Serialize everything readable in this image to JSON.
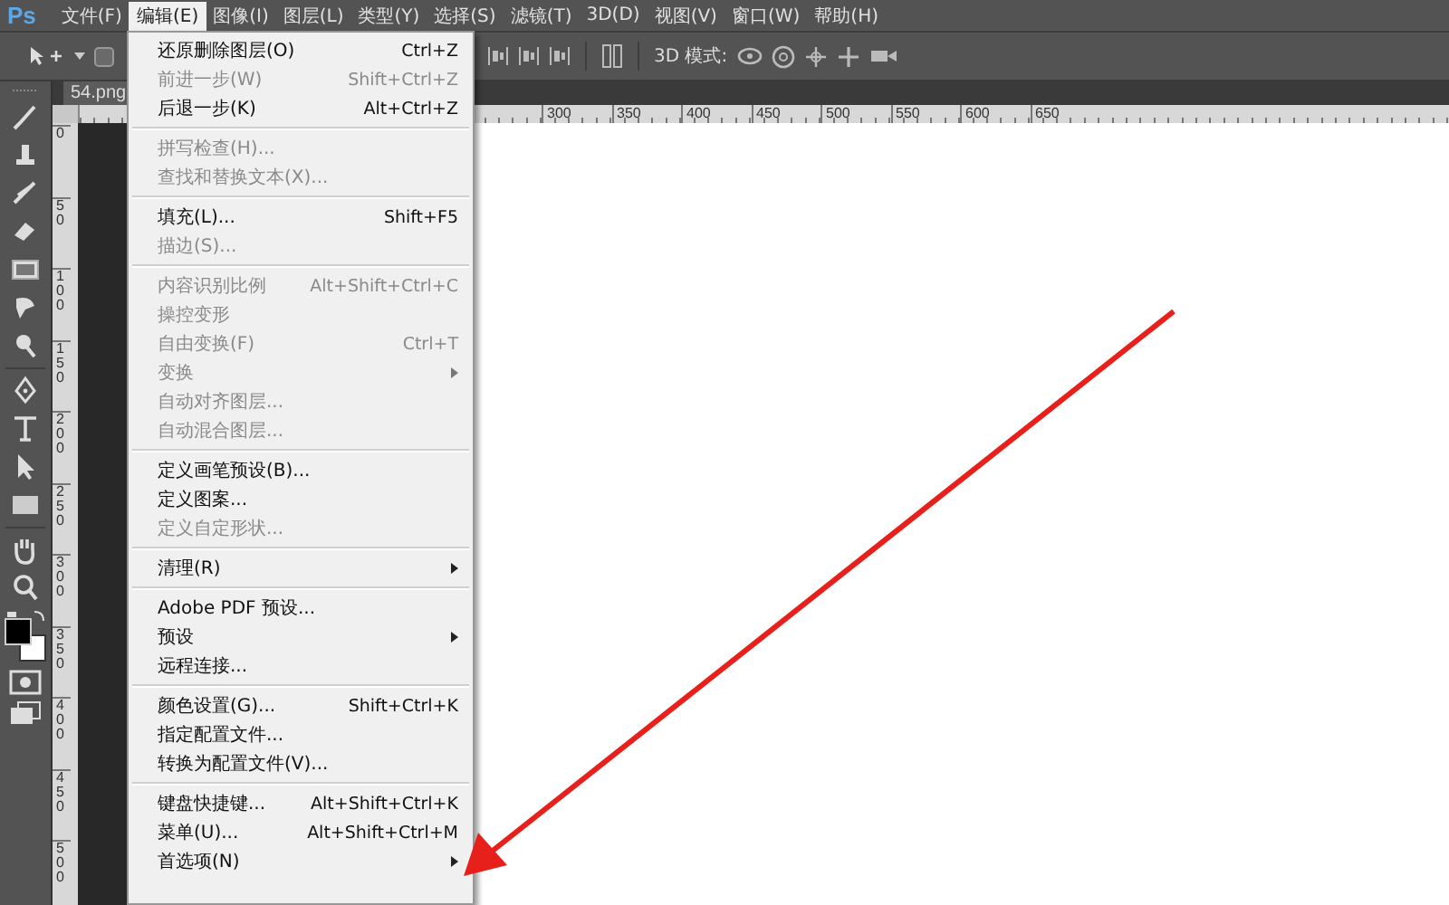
{
  "app": {
    "logo": "Ps"
  },
  "menu_bar": [
    {
      "label": "文件(F)",
      "selected": false
    },
    {
      "label": "编辑(E)",
      "selected": true
    },
    {
      "label": "图像(I)",
      "selected": false
    },
    {
      "label": "图层(L)",
      "selected": false
    },
    {
      "label": "类型(Y)",
      "selected": false
    },
    {
      "label": "选择(S)",
      "selected": false
    },
    {
      "label": "滤镜(T)",
      "selected": false
    },
    {
      "label": "3D(D)",
      "selected": false
    },
    {
      "label": "视图(V)",
      "selected": false
    },
    {
      "label": "窗口(W)",
      "selected": false
    },
    {
      "label": "帮助(H)",
      "selected": false
    }
  ],
  "options_bar": {
    "mode_label": "3D 模式:"
  },
  "document_tab": {
    "title": "54.png"
  },
  "ruler": {
    "horizontal": [
      "300",
      "350",
      "400",
      "450",
      "500",
      "550",
      "600",
      "650"
    ],
    "vertical": [
      "0",
      "50",
      "100",
      "150",
      "200",
      "250",
      "300",
      "350",
      "400",
      "450",
      "500"
    ]
  },
  "edit_menu": {
    "groups": [
      [
        {
          "label": "还原删除图层(O)",
          "shortcut": "Ctrl+Z",
          "disabled": false,
          "submenu": false
        },
        {
          "label": "前进一步(W)",
          "shortcut": "Shift+Ctrl+Z",
          "disabled": true,
          "submenu": false
        },
        {
          "label": "后退一步(K)",
          "shortcut": "Alt+Ctrl+Z",
          "disabled": false,
          "submenu": false
        }
      ],
      [
        {
          "label": "拼写检查(H)...",
          "disabled": true,
          "submenu": false
        },
        {
          "label": "查找和替换文本(X)...",
          "disabled": true,
          "submenu": false
        }
      ],
      [
        {
          "label": "填充(L)...",
          "shortcut": "Shift+F5",
          "disabled": false,
          "submenu": false
        },
        {
          "label": "描边(S)...",
          "disabled": true,
          "submenu": false
        }
      ],
      [
        {
          "label": "内容识别比例",
          "shortcut": "Alt+Shift+Ctrl+C",
          "disabled": true,
          "submenu": false
        },
        {
          "label": "操控变形",
          "disabled": true,
          "submenu": false
        },
        {
          "label": "自由变换(F)",
          "shortcut": "Ctrl+T",
          "disabled": true,
          "submenu": false
        },
        {
          "label": "变换",
          "disabled": true,
          "submenu": true
        },
        {
          "label": "自动对齐图层...",
          "disabled": true,
          "submenu": false
        },
        {
          "label": "自动混合图层...",
          "disabled": true,
          "submenu": false
        }
      ],
      [
        {
          "label": "定义画笔预设(B)...",
          "disabled": false,
          "submenu": false
        },
        {
          "label": "定义图案...",
          "disabled": false,
          "submenu": false
        },
        {
          "label": "定义自定形状...",
          "disabled": true,
          "submenu": false
        }
      ],
      [
        {
          "label": "清理(R)",
          "disabled": false,
          "submenu": true
        }
      ],
      [
        {
          "label": "Adobe PDF 预设...",
          "disabled": false,
          "submenu": false
        },
        {
          "label": "预设",
          "disabled": false,
          "submenu": true
        },
        {
          "label": "远程连接...",
          "disabled": false,
          "submenu": false
        }
      ],
      [
        {
          "label": "颜色设置(G)...",
          "shortcut": "Shift+Ctrl+K",
          "disabled": false,
          "submenu": false
        },
        {
          "label": "指定配置文件...",
          "disabled": false,
          "submenu": false
        },
        {
          "label": "转换为配置文件(V)...",
          "disabled": false,
          "submenu": false
        }
      ],
      [
        {
          "label": "键盘快捷键...",
          "shortcut": "Alt+Shift+Ctrl+K",
          "disabled": false,
          "submenu": false
        },
        {
          "label": "菜单(U)...",
          "shortcut": "Alt+Shift+Ctrl+M",
          "disabled": false,
          "submenu": false
        },
        {
          "label": "首选项(N)",
          "disabled": false,
          "submenu": true
        }
      ]
    ]
  }
}
